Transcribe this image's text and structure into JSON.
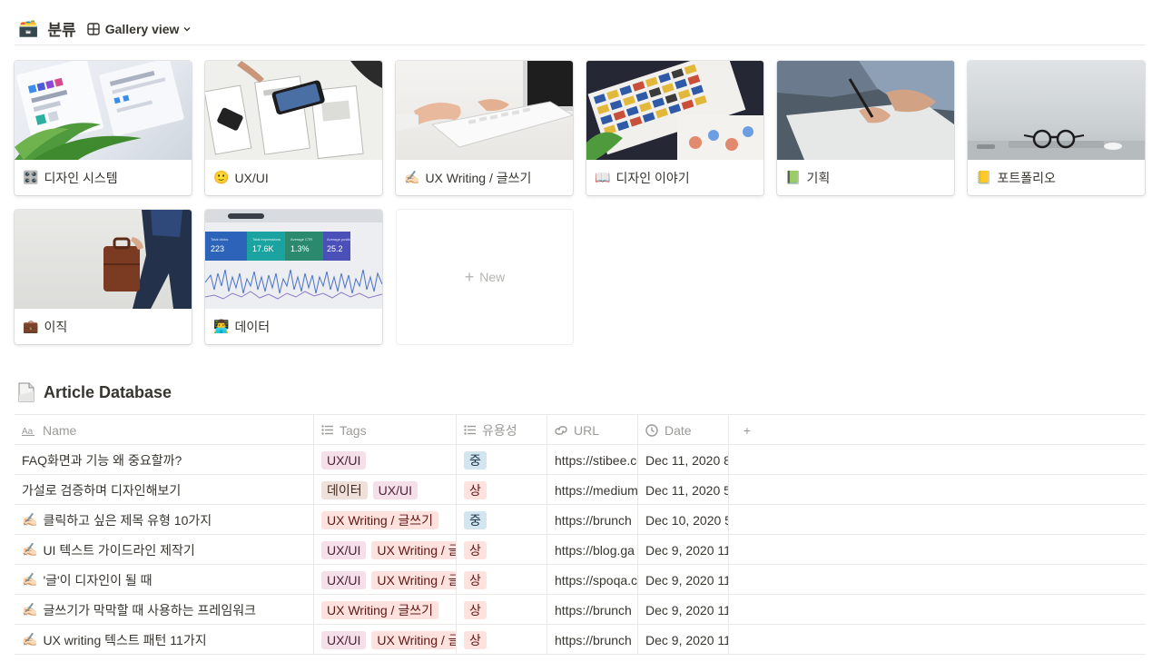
{
  "header": {
    "icon": "🗃️",
    "title": "분류",
    "view_label": "Gallery view"
  },
  "gallery": {
    "cards": [
      {
        "emoji": "🎛️",
        "label": "디자인 시스템",
        "cover": "design-system"
      },
      {
        "emoji": "🙂",
        "label": "UX/UI",
        "cover": "sketch"
      },
      {
        "emoji": "✍🏻",
        "label": "UX Writing / 글쓰기",
        "cover": "keyboard"
      },
      {
        "emoji": "📖",
        "label": "디자인 이야기",
        "cover": "swatches"
      },
      {
        "emoji": "📗",
        "label": "기획",
        "cover": "writing"
      },
      {
        "emoji": "📒",
        "label": "포트폴리오",
        "cover": "glasses"
      },
      {
        "emoji": "💼",
        "label": "이직",
        "cover": "briefcase"
      },
      {
        "emoji": "👨‍💻",
        "label": "데이터",
        "cover": "analytics"
      }
    ],
    "new_label": "New"
  },
  "database": {
    "icon": "doc-icon",
    "title": "Article Database",
    "columns": {
      "name": "Name",
      "tags": "Tags",
      "usefulness": "유용성",
      "url": "URL",
      "date": "Date"
    },
    "rows": [
      {
        "emoji": "",
        "name": "FAQ화면과 기능 왜 중요할까?",
        "tags": [
          "UX/UI"
        ],
        "usefulness": "중",
        "url": "https://stibee.com",
        "date": "Dec 11, 2020 8"
      },
      {
        "emoji": "",
        "name": "가설로 검증하며 디자인해보기",
        "tags": [
          "데이터",
          "UX/UI"
        ],
        "usefulness": "상",
        "url": "https://medium",
        "date": "Dec 11, 2020 5"
      },
      {
        "emoji": "✍🏻",
        "name": "클릭하고 싶은 제목 유형 10가지",
        "tags": [
          "UX Writing / 글쓰기"
        ],
        "usefulness": "중",
        "url": "https://brunch",
        "date": "Dec 10, 2020 5"
      },
      {
        "emoji": "✍🏻",
        "name": "UI 텍스트 가이드라인 제작기",
        "tags": [
          "UX/UI",
          "UX Writing / 글쓰기"
        ],
        "usefulness": "상",
        "url": "https://blog.ga",
        "date": "Dec 9, 2020 11"
      },
      {
        "emoji": "✍🏻",
        "name": "'글'이 디자인이 될 때",
        "tags": [
          "UX/UI",
          "UX Writing / 글쓰기"
        ],
        "usefulness": "상",
        "url": "https://spoqa.c",
        "date": "Dec 9, 2020 11"
      },
      {
        "emoji": "✍🏻",
        "name": "글쓰기가 막막할 때 사용하는 프레임워크",
        "tags": [
          "UX Writing / 글쓰기"
        ],
        "usefulness": "상",
        "url": "https://brunch",
        "date": "Dec 9, 2020 11"
      },
      {
        "emoji": "✍🏻",
        "name": "UX writing 텍스트 패턴 11가지",
        "tags": [
          "UX/UI",
          "UX Writing / 글쓰기"
        ],
        "usefulness": "상",
        "url": "https://brunch",
        "date": "Dec 9, 2020 11"
      }
    ]
  },
  "colors": {
    "text": "#37352f",
    "muted": "#9b9a97",
    "divider": "#e9e9e7",
    "tag_uxui": "#f5e0e9",
    "tag_data": "#eee0da",
    "tag_writing": "#ffe2dd",
    "use_mid": "#d3e5ef",
    "use_high": "#ffe2dd"
  }
}
